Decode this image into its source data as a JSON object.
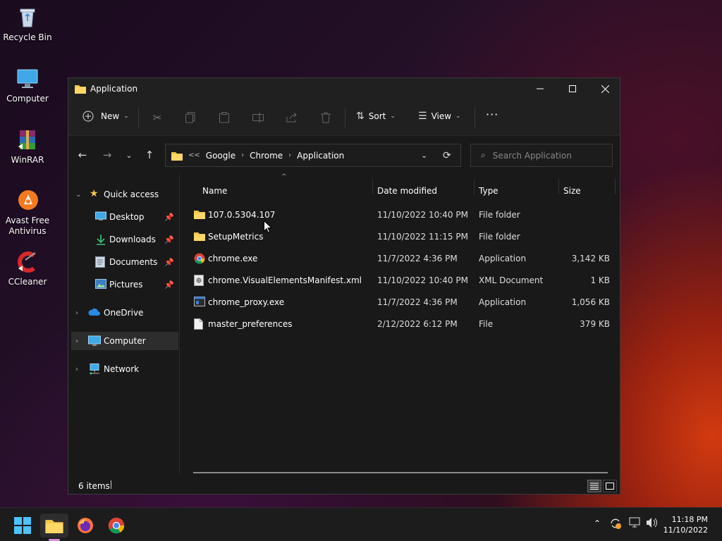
{
  "desktop": {
    "icons": [
      {
        "label": "Recycle Bin"
      },
      {
        "label": "Computer"
      },
      {
        "label": "WinRAR"
      },
      {
        "label": "Avast Free Antivirus"
      },
      {
        "label": "CCleaner"
      }
    ]
  },
  "window": {
    "title": "Application",
    "toolbar": {
      "new_label": "New",
      "sort_label": "Sort",
      "view_label": "View",
      "more_label": "···"
    },
    "address": {
      "overflow": "<<",
      "segments": [
        "Google",
        "Chrome",
        "Application"
      ]
    },
    "search": {
      "placeholder": "Search Application"
    },
    "sidebar": {
      "items": [
        {
          "label": "Quick access"
        },
        {
          "label": "Desktop"
        },
        {
          "label": "Downloads"
        },
        {
          "label": "Documents"
        },
        {
          "label": "Pictures"
        },
        {
          "label": "OneDrive"
        },
        {
          "label": "Computer"
        },
        {
          "label": "Network"
        }
      ]
    },
    "columns": {
      "name": "Name",
      "date": "Date modified",
      "type": "Type",
      "size": "Size"
    },
    "files": [
      {
        "name": "107.0.5304.107",
        "date": "11/10/2022 10:40 PM",
        "type": "File folder",
        "size": ""
      },
      {
        "name": "SetupMetrics",
        "date": "11/10/2022 11:15 PM",
        "type": "File folder",
        "size": ""
      },
      {
        "name": "chrome.exe",
        "date": "11/7/2022 4:36 PM",
        "type": "Application",
        "size": "3,142 KB"
      },
      {
        "name": "chrome.VisualElementsManifest.xml",
        "date": "11/10/2022 10:40 PM",
        "type": "XML Document",
        "size": "1 KB"
      },
      {
        "name": "chrome_proxy.exe",
        "date": "11/7/2022 4:36 PM",
        "type": "Application",
        "size": "1,056 KB"
      },
      {
        "name": "master_preferences",
        "date": "2/12/2022 6:12 PM",
        "type": "File",
        "size": "379 KB"
      }
    ],
    "status": {
      "count": "6 items"
    }
  },
  "taskbar": {
    "time": "11:18 PM",
    "date": "11/10/2022"
  },
  "colors": {
    "folder": "#f4c84a",
    "accent": "#4cc2ff",
    "window_bg": "#191919",
    "taskbar_bg": "#1c1c1c"
  }
}
